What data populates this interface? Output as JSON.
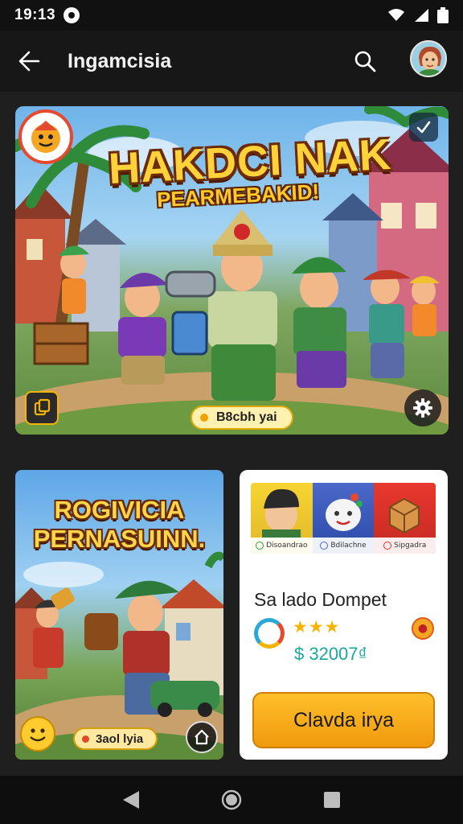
{
  "status_bar": {
    "time": "19:13"
  },
  "app_bar": {
    "title": "Ingamcisia",
    "back_icon": "arrow-left-icon",
    "search_icon": "search-icon"
  },
  "hero": {
    "title": "HAKDCI NAK",
    "subtitle": "PEARMEBAKID!",
    "pill_label": "B8cbh yai"
  },
  "game_card": {
    "title_line1": "ROGIVICIA",
    "title_line2": "PERNASUINN.",
    "pill_label": "3aol lyia"
  },
  "wallet_card": {
    "tiles": [
      {
        "label": "Disoandrao",
        "color": "#f7d432"
      },
      {
        "label": "Bdilachne",
        "color": "#4a68c8"
      },
      {
        "label": "Sipgadra",
        "color": "#e8382e"
      }
    ],
    "title": "Sa lado Dompet",
    "stars": "★★★",
    "amount": "$ 32007₫",
    "cta_label": "Clavda irya"
  },
  "colors": {
    "accent": "#f5a623",
    "background": "#1f1f1f",
    "teal": "#1aa7a0"
  }
}
